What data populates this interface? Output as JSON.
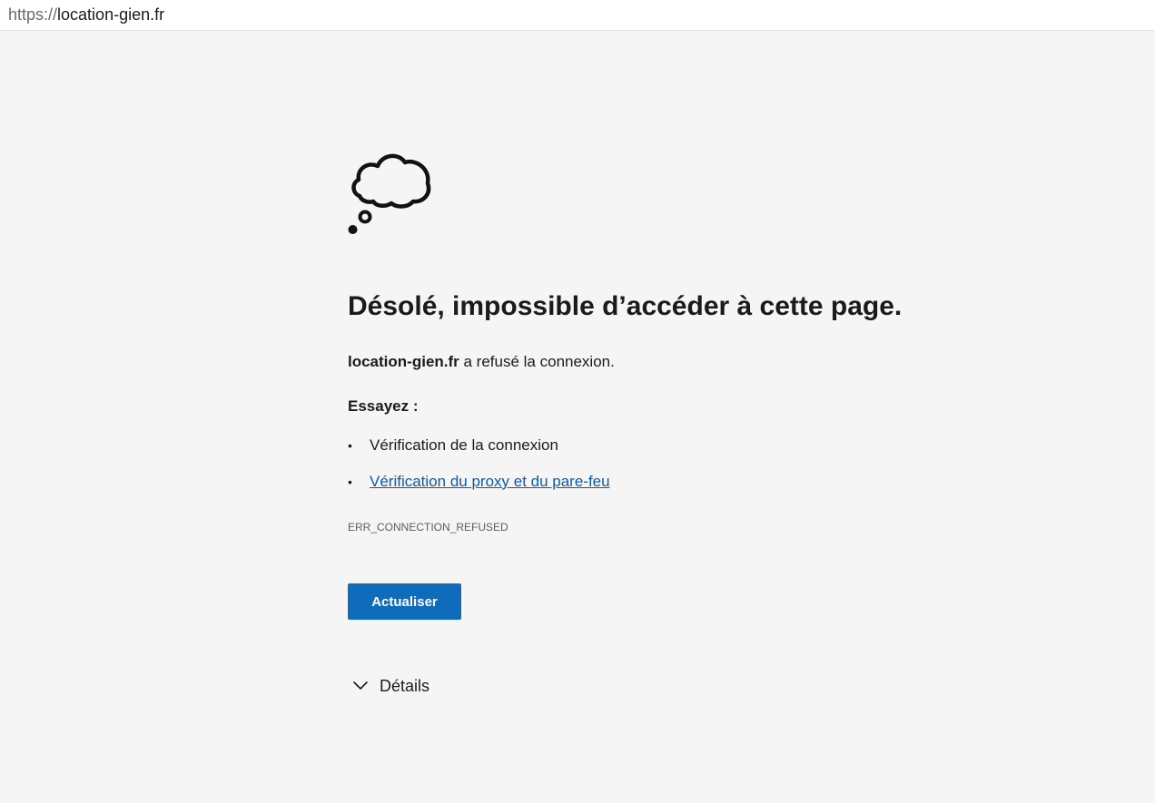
{
  "browser": {
    "url_scheme": "https://",
    "url_host": "location-gien.fr"
  },
  "error": {
    "icon": "thought-cloud-icon",
    "title": "Désolé, impossible d’accéder à cette page.",
    "domain": "location-gien.fr",
    "message_suffix": " a refusé la connexion.",
    "try_heading": "Essayez :",
    "suggestions": [
      {
        "label": "Vérification de la connexion",
        "link": false
      },
      {
        "label": "Vérification du proxy et du pare-feu",
        "link": true
      }
    ],
    "code": "ERR_CONNECTION_REFUSED",
    "refresh_label": "Actualiser",
    "details_label": "Détails"
  },
  "colors": {
    "background": "#f5f5f5",
    "button": "#0f6cbd",
    "link": "#0b5cad"
  }
}
